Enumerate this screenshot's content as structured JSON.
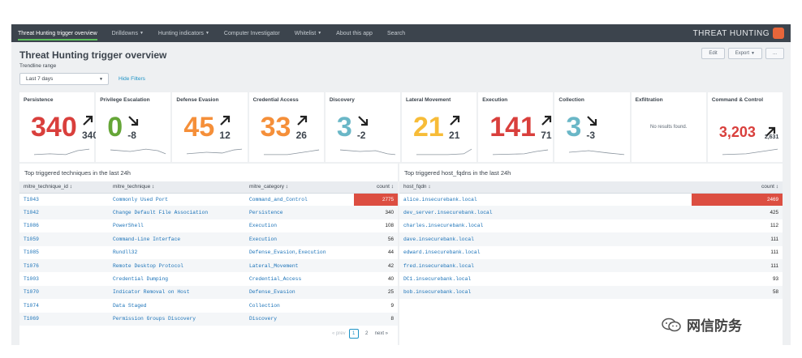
{
  "nav": {
    "items": [
      {
        "label": "Threat Hunting trigger overview",
        "active": true,
        "caret": false
      },
      {
        "label": "Drilldowns",
        "active": false,
        "caret": true
      },
      {
        "label": "Hunting indicators",
        "active": false,
        "caret": true
      },
      {
        "label": "Computer Investigator",
        "active": false,
        "caret": false
      },
      {
        "label": "Whitelist",
        "active": false,
        "caret": true
      },
      {
        "label": "About this app",
        "active": false,
        "caret": false
      },
      {
        "label": "Search",
        "active": false,
        "caret": false
      }
    ],
    "brand": "THREAT HUNTING"
  },
  "header": {
    "title": "Threat Hunting trigger overview",
    "edit_label": "Edit",
    "export_label": "Export",
    "more_label": "..."
  },
  "filters": {
    "range_label": "Trendline range",
    "range_value": "Last 7 days",
    "hide_filters": "Hide Filters"
  },
  "tiles": [
    {
      "name": "Persistence",
      "value": "340",
      "delta": "340",
      "direction": "up",
      "color": "#d93f3c"
    },
    {
      "name": "Privilege Escalation",
      "value": "0",
      "delta": "-8",
      "direction": "down",
      "color": "#65a637"
    },
    {
      "name": "Defense Evasion",
      "value": "45",
      "delta": "12",
      "direction": "up",
      "color": "#f58f39"
    },
    {
      "name": "Credential Access",
      "value": "33",
      "delta": "26",
      "direction": "up",
      "color": "#f58f39"
    },
    {
      "name": "Discovery",
      "value": "3",
      "delta": "-2",
      "direction": "down",
      "color": "#6ab7c7"
    },
    {
      "name": "Lateral Movement",
      "value": "21",
      "delta": "21",
      "direction": "up",
      "color": "#f7bc38"
    },
    {
      "name": "Execution",
      "value": "141",
      "delta": "71",
      "direction": "up",
      "color": "#d93f3c"
    },
    {
      "name": "Collection",
      "value": "3",
      "delta": "-3",
      "direction": "down",
      "color": "#6ab7c7"
    },
    {
      "name": "Exfiltration",
      "value": "",
      "delta": "",
      "direction": "none",
      "color": "#5c6773",
      "no_results": "No results found."
    },
    {
      "name": "Command & Control",
      "value": "3,203",
      "delta": "2,631",
      "direction": "up",
      "color": "#d93f3c"
    }
  ],
  "techniques": {
    "title": "Top triggered techniques in the last 24h",
    "columns": [
      "mitre_technique_id ↕",
      "mitre_technique ↕",
      "mitre_category ↕",
      "count ↕"
    ],
    "rows": [
      {
        "id": "T1043",
        "technique": "Commonly Used Port",
        "category": "Command_and_Control",
        "count": "2775",
        "hot": true
      },
      {
        "id": "T1042",
        "technique": "Change Default File Association",
        "category": "Persistence",
        "count": "340",
        "hot": false
      },
      {
        "id": "T1086",
        "technique": "PowerShell",
        "category": "Execution",
        "count": "108",
        "hot": false
      },
      {
        "id": "T1059",
        "technique": "Command-Line Interface",
        "category": "Execution",
        "count": "56",
        "hot": false
      },
      {
        "id": "T1085",
        "technique": "Rundll32",
        "category": "Defense_Evasion,Execution",
        "count": "44",
        "hot": false
      },
      {
        "id": "T1076",
        "technique": "Remote Desktop Protocol",
        "category": "Lateral_Movement",
        "count": "42",
        "hot": false
      },
      {
        "id": "T1003",
        "technique": "Credential Dumping",
        "category": "Credential_Access",
        "count": "40",
        "hot": false
      },
      {
        "id": "T1070",
        "technique": "Indicator Removal on Host",
        "category": "Defense_Evasion",
        "count": "25",
        "hot": false
      },
      {
        "id": "T1074",
        "technique": "Data Staged",
        "category": "Collection",
        "count": "9",
        "hot": false
      },
      {
        "id": "T1069",
        "technique": "Permission Groups Discovery",
        "category": "Discovery",
        "count": "8",
        "hot": false
      }
    ],
    "pager": {
      "prev": "« prev",
      "pages": [
        "1",
        "2"
      ],
      "next": "next »"
    }
  },
  "hosts": {
    "title": "Top triggered host_fqdns in the last 24h",
    "columns": [
      "host_fqdn ↕",
      "count ↕"
    ],
    "rows": [
      {
        "host": "alice.insecurebank.local",
        "count": "2469",
        "hot": true
      },
      {
        "host": "dev_server.insecurebank.local",
        "count": "425",
        "hot": false
      },
      {
        "host": "charles.insecurebank.local",
        "count": "112",
        "hot": false
      },
      {
        "host": "dave.insecurebank.local",
        "count": "111",
        "hot": false
      },
      {
        "host": "edward.insecurebank.local",
        "count": "111",
        "hot": false
      },
      {
        "host": "fred.insecurebank.local",
        "count": "111",
        "hot": false
      },
      {
        "host": "DC1.insecurebank.local",
        "count": "93",
        "hot": false
      },
      {
        "host": "bob.insecurebank.local",
        "count": "58",
        "hot": false
      }
    ]
  },
  "watermark": {
    "text": "网信防务"
  }
}
